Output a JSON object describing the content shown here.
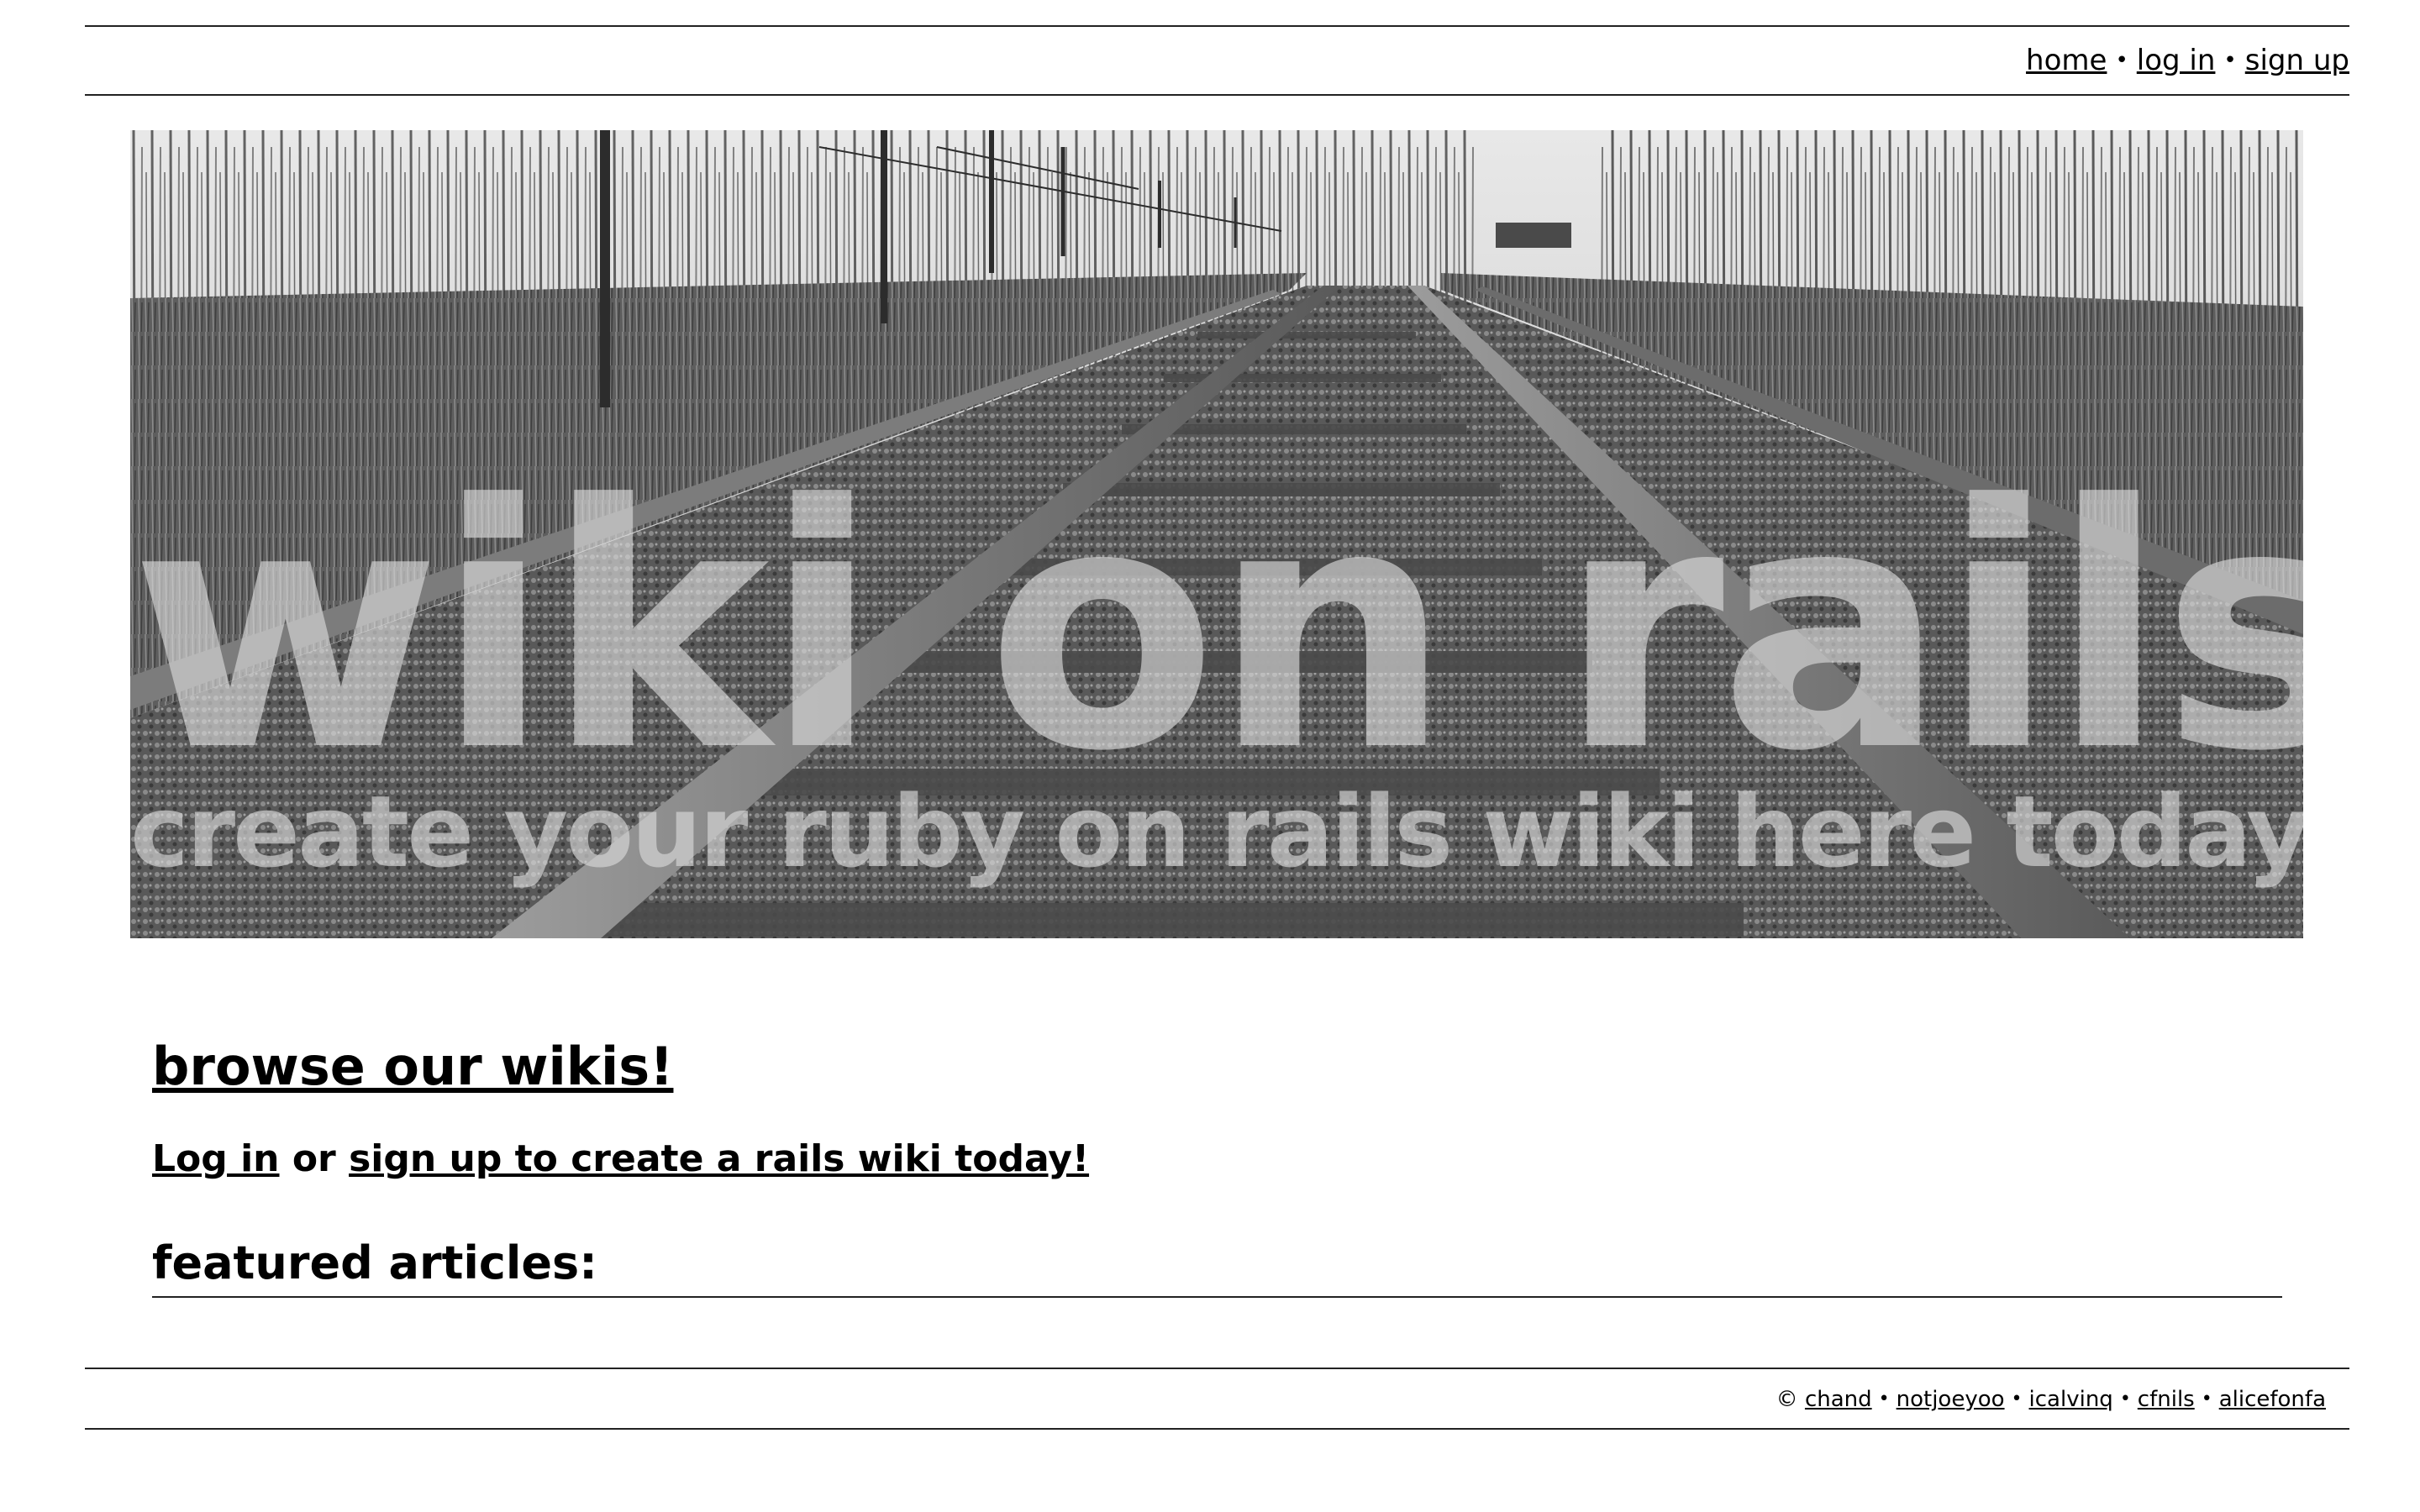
{
  "nav": {
    "home": "home",
    "sep1": "•",
    "login": "log in",
    "sep2": "•",
    "signup": "sign up"
  },
  "banner": {
    "title": "wiki on rails",
    "subtitle": "create your ruby on rails wiki here today"
  },
  "main": {
    "browse": "browse our wikis!",
    "login_link": "Log in",
    "or_text": "or",
    "signup_link": "sign up to create a rails wiki today!",
    "featured_heading": "featured articles:"
  },
  "footer": {
    "copyright": "©",
    "authors": [
      "chand",
      "notjoeyoo",
      "icalvinq",
      "cfnils",
      "alicefonfa"
    ],
    "sep": "•"
  }
}
